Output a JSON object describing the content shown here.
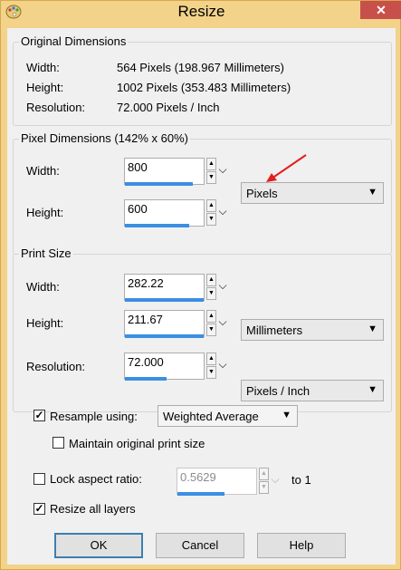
{
  "window": {
    "title": "Resize",
    "close_glyph": "✕"
  },
  "original_dimensions": {
    "legend": "Original Dimensions",
    "width_label": "Width:",
    "width_value": "564 Pixels (198.967 Millimeters)",
    "height_label": "Height:",
    "height_value": "1002 Pixels (353.483 Millimeters)",
    "resolution_label": "Resolution:",
    "resolution_value": "72.000 Pixels / Inch"
  },
  "pixel_dimensions": {
    "legend": "Pixel Dimensions (142% x 60%)",
    "width_label": "Width:",
    "width_value": "800",
    "height_label": "Height:",
    "height_value": "600",
    "unit": "Pixels"
  },
  "print_size": {
    "legend": "Print Size",
    "width_label": "Width:",
    "width_value": "282.22",
    "height_label": "Height:",
    "height_value": "211.67",
    "resolution_label": "Resolution:",
    "resolution_value": "72.000",
    "size_unit": "Millimeters",
    "resolution_unit": "Pixels / Inch"
  },
  "options": {
    "resample_label": "Resample using:",
    "resample_checked": true,
    "resample_method": "Weighted Average",
    "maintain_print_label": "Maintain original print size",
    "maintain_print_checked": false,
    "lock_aspect_label": "Lock aspect ratio:",
    "lock_aspect_checked": false,
    "aspect_value": "0.5629",
    "aspect_suffix": "to 1",
    "resize_layers_label": "Resize all layers",
    "resize_layers_checked": true
  },
  "buttons": {
    "ok": "OK",
    "cancel": "Cancel",
    "help": "Help"
  },
  "colors": {
    "accent": "#3b8fe3",
    "annotation_arrow": "#e0201e",
    "close": "#c7514a"
  },
  "icons": {
    "app": "paint-palette-icon",
    "annotation": "red-arrow-icon"
  }
}
